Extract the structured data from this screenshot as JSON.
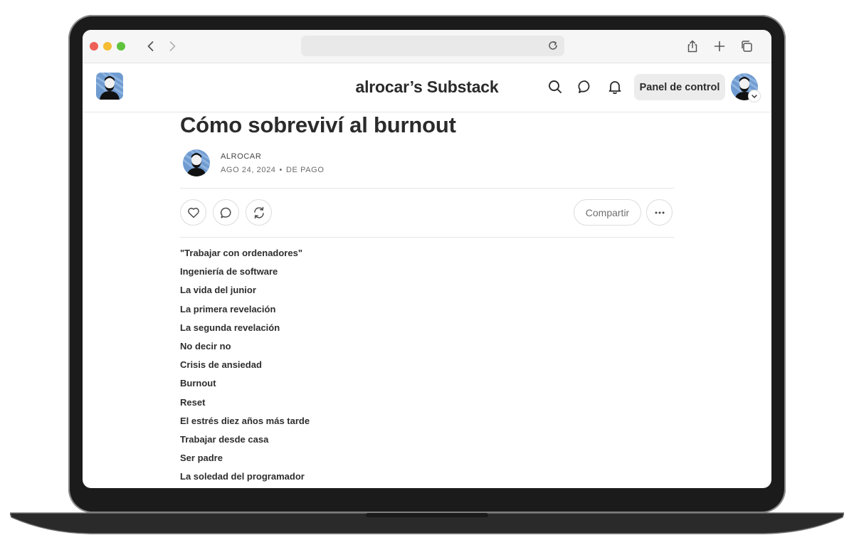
{
  "browser": {
    "traffic_lights": {
      "red": "#ee5f57",
      "yellow": "#f4bd32",
      "green": "#5fc33e"
    },
    "url": ""
  },
  "site": {
    "publication_title": "alrocar’s Substack",
    "panel_button": "Panel de control"
  },
  "article": {
    "title": "Cómo sobreviví al burnout",
    "author": "ALROCAR",
    "date": "AGO 24, 2024",
    "access": "DE PAGO",
    "share_label": "Compartir",
    "toc": [
      "\"Trabajar con ordenadores\"",
      "Ingeniería de software",
      "La vida del junior",
      "La primera revelación",
      "La segunda revelación",
      "No decir no",
      "Crisis de ansiedad",
      "Burnout",
      "Reset",
      "El estrés diez años más tarde",
      "Trabajar desde casa",
      "Ser padre",
      "La soledad del programador"
    ]
  }
}
